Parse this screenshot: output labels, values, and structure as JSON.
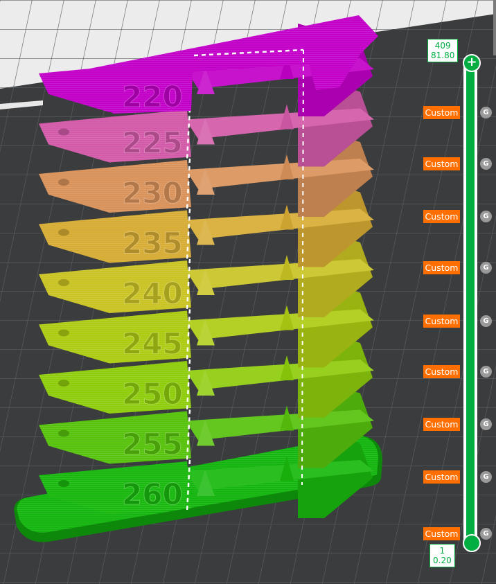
{
  "slider": {
    "top": {
      "layer": "409",
      "height": "81.80"
    },
    "bottom": {
      "layer": "1",
      "height": "0.20"
    },
    "accent_color": "#00ae42"
  },
  "markers": [
    {
      "label": "Custom",
      "g": "G"
    },
    {
      "label": "Custom",
      "g": "G"
    },
    {
      "label": "Custom",
      "g": "G"
    },
    {
      "label": "Custom",
      "g": "G"
    },
    {
      "label": "Custom",
      "g": "G"
    },
    {
      "label": "Custom",
      "g": "G"
    },
    {
      "label": "Custom",
      "g": "G"
    },
    {
      "label": "Custom",
      "g": "G"
    },
    {
      "label": "Custom",
      "g": "G"
    }
  ],
  "tower": {
    "temperatures": [
      "220",
      "225",
      "230",
      "235",
      "240",
      "245",
      "250",
      "255",
      "260"
    ],
    "colors": [
      "#c200c8",
      "#d25aa8",
      "#d9925a",
      "#d7ac34",
      "#c9c323",
      "#aecb13",
      "#8ecc0c",
      "#57c20c",
      "#19b80e"
    ],
    "base_color": "#13b50e"
  },
  "colors": {
    "marker": "#ff6f00",
    "g_dot": "#9a9a9a",
    "plate": "#3a3c3e"
  }
}
